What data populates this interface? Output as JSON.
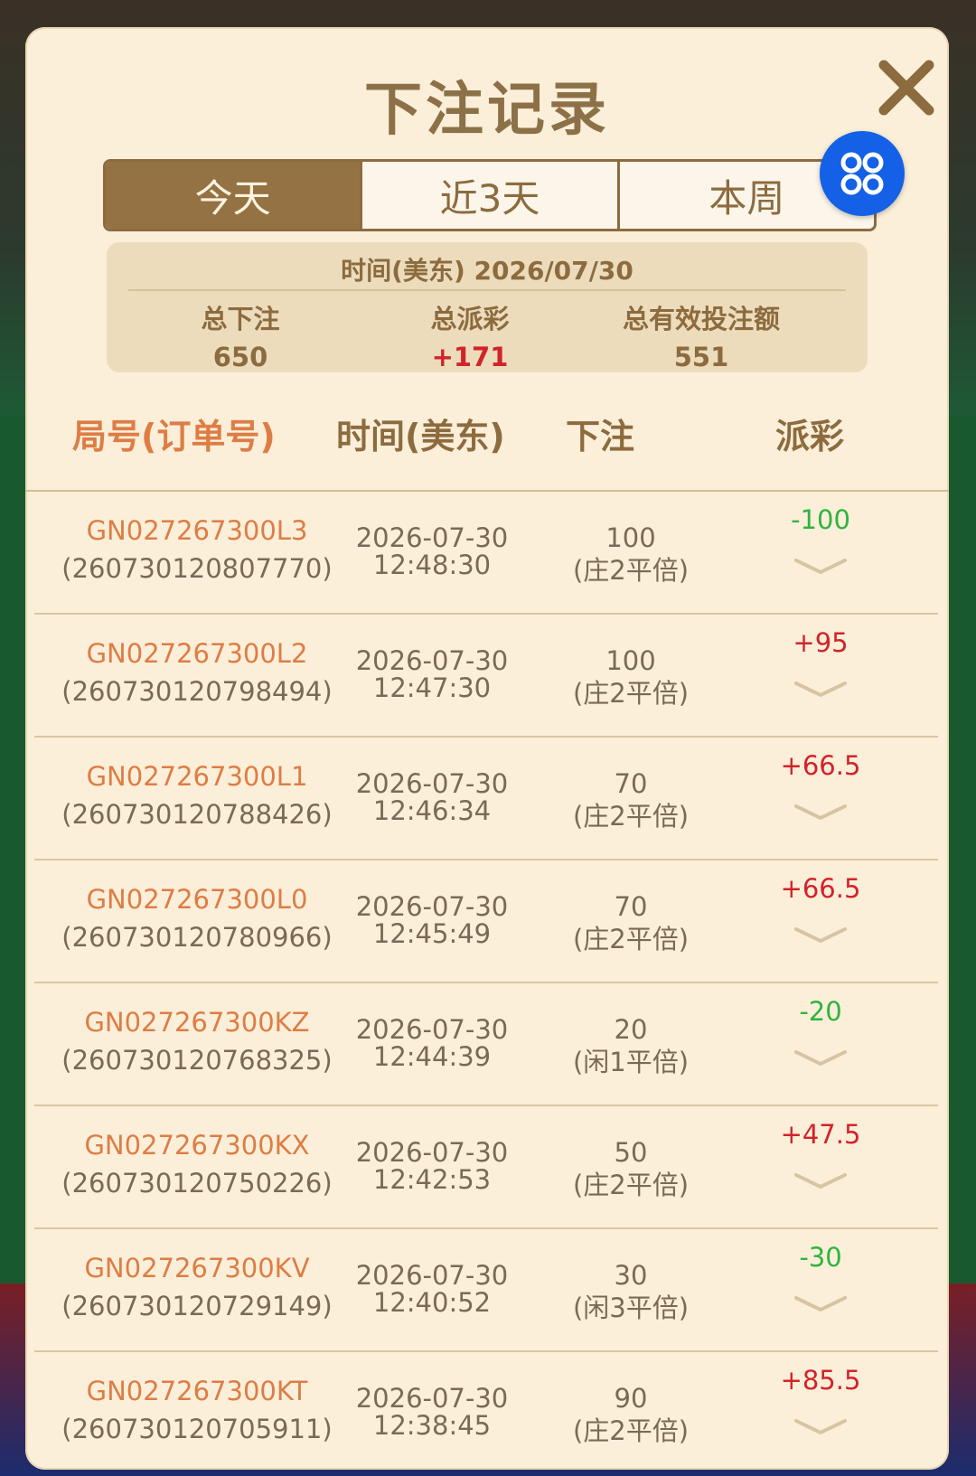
{
  "title": "下注记录",
  "tabs": [
    "今天",
    "近3天",
    "本周"
  ],
  "summary": {
    "date_label": "时间(美东) 2026/07/30",
    "total_bet_label": "总下注",
    "total_bet": "650",
    "total_payout_label": "总派彩",
    "total_payout": "+171",
    "valid_bet_label": "总有效投注额",
    "valid_bet": "551"
  },
  "columns": [
    "局号(订单号)",
    "时间(美东)",
    "下注",
    "派彩"
  ],
  "rows": [
    {
      "id": "GN027267300L3",
      "order": "(260730120807770)",
      "date": "2026-07-30",
      "time": "12:48:30",
      "amount": "100",
      "type": "(庄2平倍)",
      "payout": "-100"
    },
    {
      "id": "GN027267300L2",
      "order": "(260730120798494)",
      "date": "2026-07-30",
      "time": "12:47:30",
      "amount": "100",
      "type": "(庄2平倍)",
      "payout": "+95"
    },
    {
      "id": "GN027267300L1",
      "order": "(260730120788426)",
      "date": "2026-07-30",
      "time": "12:46:34",
      "amount": "70",
      "type": "(庄2平倍)",
      "payout": "+66.5"
    },
    {
      "id": "GN027267300L0",
      "order": "(260730120780966)",
      "date": "2026-07-30",
      "time": "12:45:49",
      "amount": "70",
      "type": "(庄2平倍)",
      "payout": "+66.5"
    },
    {
      "id": "GN027267300KZ",
      "order": "(260730120768325)",
      "date": "2026-07-30",
      "time": "12:44:39",
      "amount": "20",
      "type": "(闲1平倍)",
      "payout": "-20"
    },
    {
      "id": "GN027267300KX",
      "order": "(260730120750226)",
      "date": "2026-07-30",
      "time": "12:42:53",
      "amount": "50",
      "type": "(庄2平倍)",
      "payout": "+47.5"
    },
    {
      "id": "GN027267300KV",
      "order": "(260730120729149)",
      "date": "2026-07-30",
      "time": "12:40:52",
      "amount": "30",
      "type": "(闲3平倍)",
      "payout": "-30"
    },
    {
      "id": "GN027267300KT",
      "order": "(260730120705911)",
      "date": "2026-07-30",
      "time": "12:38:45",
      "amount": "90",
      "type": "(庄2平倍)",
      "payout": "+85.5"
    }
  ],
  "colors": {
    "panel": "#fbefd9",
    "accent": "#957243",
    "order_id": "#dd7d45",
    "positive": "#d2232b",
    "negative": "#2fb43e",
    "menu_button": "#1460e6"
  },
  "icons": {
    "close": "close-icon",
    "menu": "grid-menu-icon",
    "expand": "chevron-down-icon"
  }
}
